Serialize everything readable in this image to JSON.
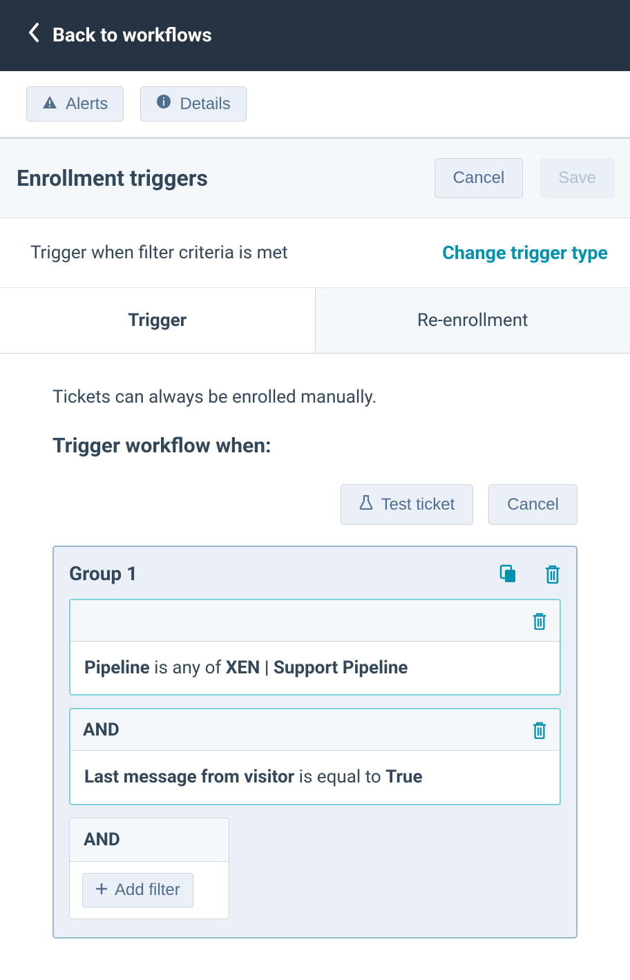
{
  "topbar": {
    "back_label": "Back to workflows"
  },
  "toolbar": {
    "alerts_label": "Alerts",
    "details_label": "Details"
  },
  "section": {
    "title": "Enrollment triggers",
    "cancel_label": "Cancel",
    "save_label": "Save"
  },
  "trigger_type": {
    "description": "Trigger when filter criteria is met",
    "change_label": "Change trigger type"
  },
  "tabs": {
    "trigger": "Trigger",
    "reenrollment": "Re-enrollment"
  },
  "content": {
    "hint": "Tickets can always be enrolled manually.",
    "subhead": "Trigger workflow when:",
    "test_label": "Test ticket",
    "cancel_label": "Cancel"
  },
  "group": {
    "title": "Group 1",
    "filters": [
      {
        "and": false,
        "property": "Pipeline",
        "operator": " is any of ",
        "value": "XEN | Support Pipeline"
      },
      {
        "and": true,
        "and_label": "AND",
        "property": "Last message from visitor",
        "operator": " is equal to ",
        "value": "True"
      }
    ],
    "add": {
      "and_label": "AND",
      "button_label": "Add filter"
    }
  }
}
